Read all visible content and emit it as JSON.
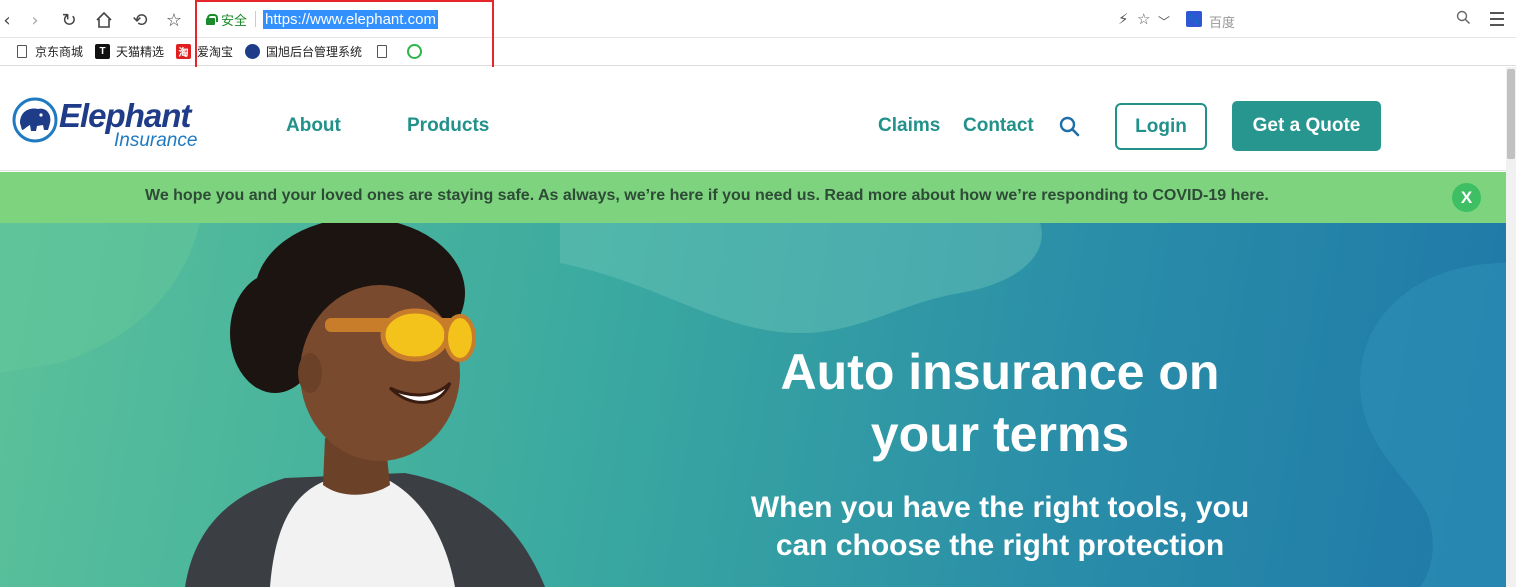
{
  "browser": {
    "secure_label": "安全",
    "url": "https://www.elephant.com",
    "search_engine_label": "百度",
    "bookmarks": [
      {
        "label": "京东商城"
      },
      {
        "label": "天猫精选"
      },
      {
        "label": "爱淘宝"
      },
      {
        "label": "国旭后台管理系统"
      },
      {
        "label": ""
      },
      {
        "label": ""
      }
    ]
  },
  "site": {
    "logo_word": "Elephant",
    "logo_sub": "Insurance",
    "nav": {
      "about": "About",
      "products": "Products",
      "claims": "Claims",
      "contact": "Contact"
    },
    "login_label": "Login",
    "quote_label": "Get a Quote"
  },
  "banner": {
    "text": "We hope you and your loved ones are staying safe. As always, we’re here if you need us. Read more about how we’re responding to COVID-19 here.",
    "close_label": "X"
  },
  "hero": {
    "title_line1": "Auto insurance on",
    "title_line2": "your terms",
    "subtitle_line1": "When you have the right tools, you",
    "subtitle_line2": "can choose the right protection"
  },
  "colors": {
    "brand_teal": "#22918a",
    "banner_green": "#7ed47e",
    "highlight_red": "#e5262a"
  }
}
